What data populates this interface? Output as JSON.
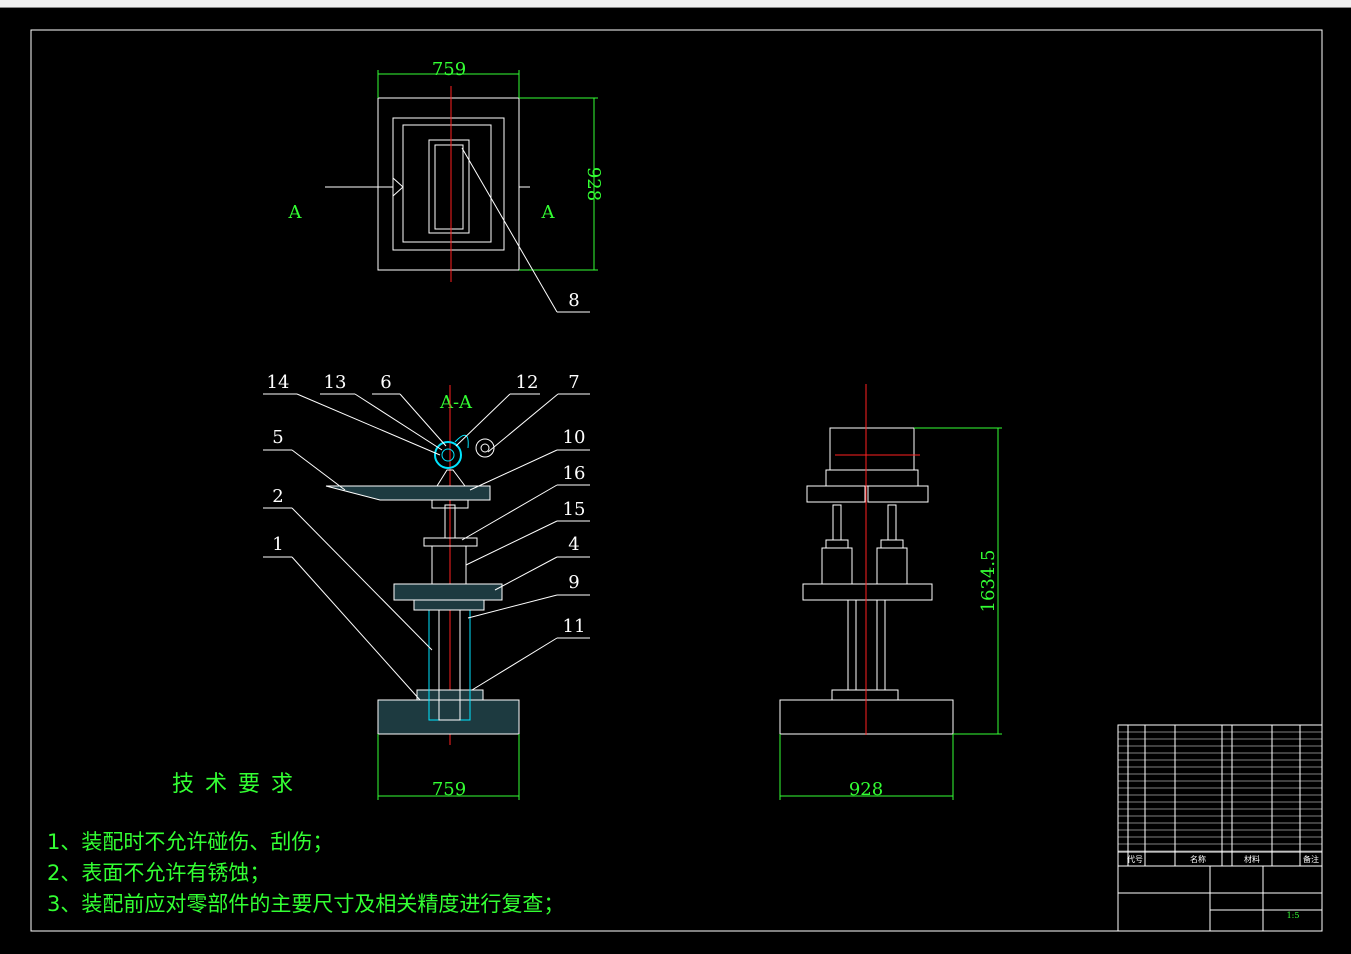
{
  "drawing": {
    "top_view": {
      "width_dim": "759",
      "height_dim": "928",
      "section_mark_left": "A",
      "section_mark_right": "A",
      "balloon": "8"
    },
    "section_view": {
      "title": "A-A",
      "bottom_dim": "759",
      "balloons_left": [
        "14",
        "13",
        "6",
        "5",
        "2",
        "1"
      ],
      "balloons_right": [
        "12",
        "7",
        "10",
        "16",
        "15",
        "4",
        "9",
        "11"
      ]
    },
    "side_view": {
      "height_dim": "1634.5",
      "width_dim": "928"
    },
    "notes": {
      "heading": "技 术 要 求",
      "items": [
        "1、装配时不允许碰伤、刮伤；",
        "2、表面不允许有锈蚀；",
        "3、装配前应对零部件的主要尺寸及相关精度进行复查；"
      ]
    },
    "title_block": {
      "header_cols": [
        "代号",
        "名称",
        "材料",
        "备注"
      ],
      "scale": "1:5"
    },
    "colors": {
      "background": "#000000",
      "outline": "#ffffff",
      "dimension": "#33ff33",
      "centerline": "#ff2020",
      "hidden_part": "#00e5ff"
    }
  }
}
